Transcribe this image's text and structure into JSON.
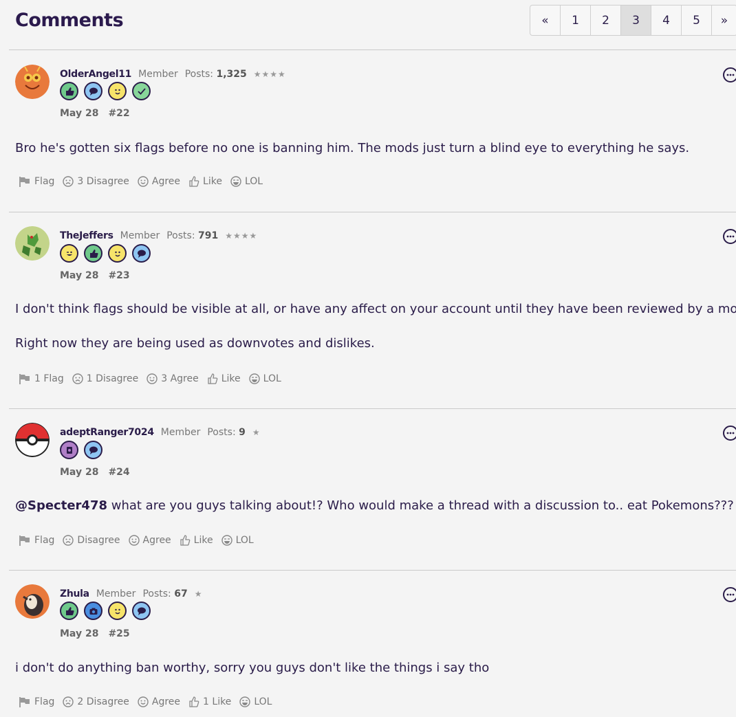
{
  "header": {
    "title": "Comments"
  },
  "pager": [
    "«",
    "1",
    "2",
    "3",
    "4",
    "5",
    "»"
  ],
  "pager_active": "3",
  "comments": [
    {
      "username": "OlderAngel11",
      "role": "Member",
      "posts_label": "Posts:",
      "posts": "1,325",
      "stars": "★★★★",
      "date": "May 28",
      "number": "#22",
      "badges": [
        "thumbs-up",
        "speech",
        "smiley",
        "check"
      ],
      "paragraphs": [
        "Bro he's gotten six flags before no one is banning him. The mods just turn a blind eye to everything he says."
      ],
      "actions": {
        "flag": "Flag",
        "disagree": "3 Disagree",
        "agree": "Agree",
        "like": "Like",
        "lol": "LOL"
      }
    },
    {
      "username": "TheJeffers",
      "role": "Member",
      "posts_label": "Posts:",
      "posts": "791",
      "stars": "★★★★",
      "date": "May 28",
      "number": "#23",
      "badges": [
        "wink",
        "thumbs-up",
        "smiley",
        "speech"
      ],
      "paragraphs": [
        "I don't think flags should be visible at all, or have any affect on your account until they have been reviewed by a mod.",
        "Right now they are being used as downvotes and dislikes."
      ],
      "actions": {
        "flag": "1 Flag",
        "disagree": "1 Disagree",
        "agree": "3 Agree",
        "like": "Like",
        "lol": "LOL"
      }
    },
    {
      "username": "adeptRanger7024",
      "role": "Member",
      "posts_label": "Posts:",
      "posts": "9",
      "stars": "★",
      "date": "May 28",
      "number": "#24",
      "badges": [
        "tablet",
        "speech"
      ],
      "mention": "@Specter478",
      "paragraphs": [
        "what are you guys talking about!? Who would make a thread with a discussion to.. eat Pokemons???"
      ],
      "actions": {
        "flag": "Flag",
        "disagree": "Disagree",
        "agree": "Agree",
        "like": "Like",
        "lol": "LOL"
      }
    },
    {
      "username": "Zhula",
      "role": "Member",
      "posts_label": "Posts:",
      "posts": "67",
      "stars": "★",
      "date": "May 28",
      "number": "#25",
      "badges": [
        "thumbs-up",
        "camera",
        "smiley",
        "speech"
      ],
      "paragraphs": [
        "i don't do anything ban worthy, sorry you guys don't like the things i say tho"
      ],
      "actions": {
        "flag": "Flag",
        "disagree": "2 Disagree",
        "agree": "Agree",
        "like": "1 Like",
        "lol": "LOL"
      }
    }
  ],
  "colors": {
    "text": "#2a1c49",
    "muted": "#777777",
    "border": "#c9c9c9",
    "bg": "#f4f4f4"
  }
}
